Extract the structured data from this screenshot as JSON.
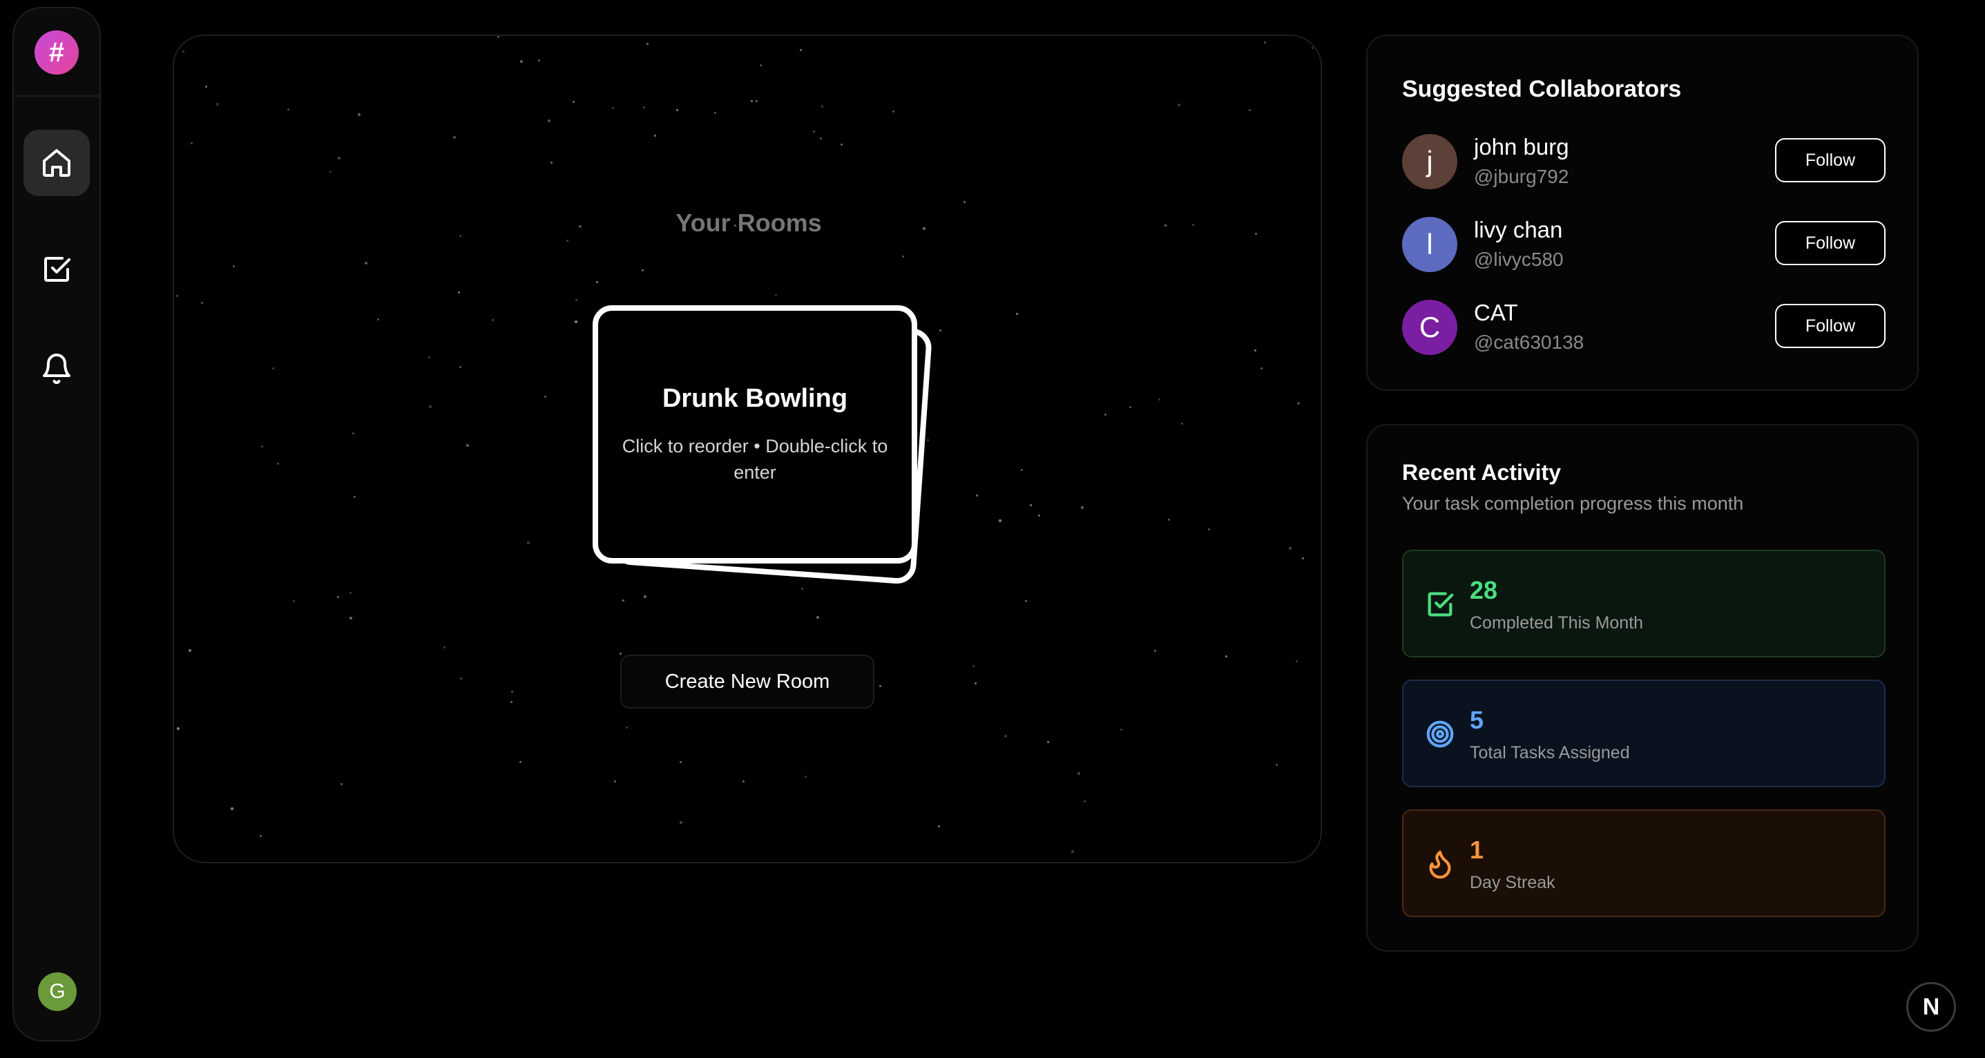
{
  "colors": {
    "background": "#000000",
    "logo_gradient": [
      "#c94ad9",
      "#e3459b"
    ],
    "user_avatar": "#6a9a3a",
    "completed": "#4ade80",
    "assigned": "#60a5fa",
    "streak": "#fb923c"
  },
  "sidebar": {
    "logo_glyph": "#",
    "nav": [
      {
        "name": "home",
        "icon": "home-icon",
        "active": true
      },
      {
        "name": "tasks",
        "icon": "checkbox-icon",
        "active": false
      },
      {
        "name": "notifications",
        "icon": "bell-icon",
        "active": false
      }
    ],
    "user_initial": "G"
  },
  "rooms": {
    "title": "Your Rooms",
    "room_card": {
      "name": "Drunk Bowling",
      "hint": "Click to reorder • Double-click to enter"
    },
    "create_button_label": "Create New Room"
  },
  "collaborators": {
    "title": "Suggested Collaborators",
    "follow_label": "Follow",
    "items": [
      {
        "initial": "j",
        "name": "john burg",
        "handle": "@jburg792",
        "color": "#5d4037"
      },
      {
        "initial": "l",
        "name": "livy chan",
        "handle": "@livyc580",
        "color": "#5c6bc0"
      },
      {
        "initial": "C",
        "name": "CAT",
        "handle": "@cat630138",
        "color": "#7b1fa2"
      }
    ]
  },
  "activity": {
    "title": "Recent Activity",
    "subtitle": "Your task completion progress this month",
    "stats": [
      {
        "value": "28",
        "label": "Completed This Month",
        "icon": "check-square-icon"
      },
      {
        "value": "5",
        "label": "Total Tasks Assigned",
        "icon": "target-icon"
      },
      {
        "value": "1",
        "label": "Day Streak",
        "icon": "flame-icon"
      }
    ]
  },
  "framework_badge": "N"
}
